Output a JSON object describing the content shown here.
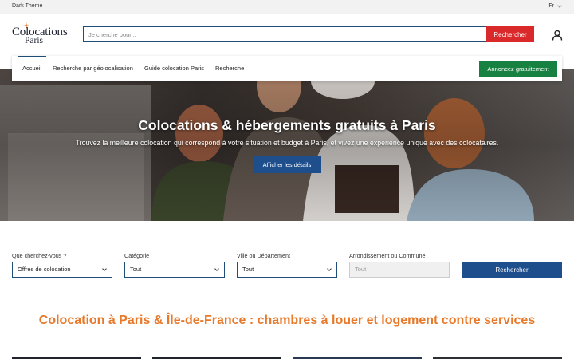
{
  "topbar": {
    "theme_label": "Dark Theme",
    "language": "Fr"
  },
  "header": {
    "logo_line1": "Colocations",
    "logo_line2": "Paris",
    "search_placeholder": "Je cherche pour...",
    "search_button": "Rechercher",
    "user_icon": "user-icon"
  },
  "nav": {
    "items": [
      {
        "label": "Accueil",
        "active": true
      },
      {
        "label": "Recherche par géolocalisation"
      },
      {
        "label": "Guide colocation Paris"
      },
      {
        "label": "Recherche"
      }
    ],
    "cta": "Annoncez gratuitement"
  },
  "hero": {
    "title": "Colocations & hébergements gratuits à Paris",
    "subtitle": "Trouvez la meilleure colocation qui correspond à votre situation et budget à Paris, et vivez une expérience unique avec des colocataires.",
    "button": "Afficher les détails"
  },
  "filters": [
    {
      "label": "Que cherchez-vous ?",
      "value": "Offres de colocation"
    },
    {
      "label": "Catégorie",
      "value": "Tout"
    },
    {
      "label": "Ville ou Département",
      "value": "Tout"
    },
    {
      "label": "Arrondissement ou Commune",
      "value": "Tout",
      "disabled": true
    }
  ],
  "filter_search_button": "Rechercher",
  "section_title": "Colocation à Paris & Île-de-France : chambres à louer et logement contre services",
  "colors": {
    "primary": "#1f4e8c",
    "accent_red": "#d9292b",
    "cta_green": "#178142",
    "title_orange": "#e8792a"
  }
}
